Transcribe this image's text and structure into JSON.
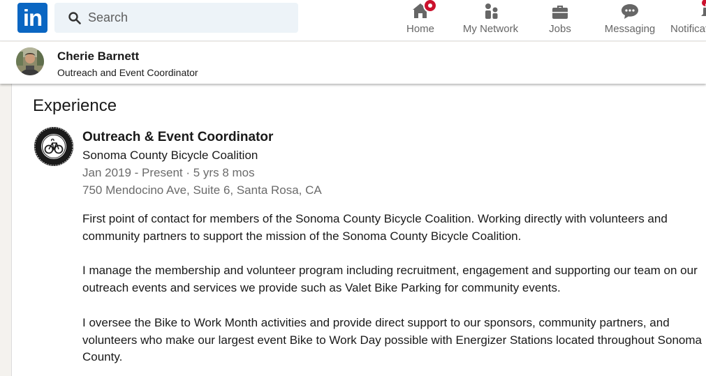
{
  "nav": {
    "logo_text": "in",
    "search_placeholder": "Search",
    "items": [
      {
        "label": "Home",
        "icon": "home-icon",
        "badge": true
      },
      {
        "label": "My Network",
        "icon": "network-icon"
      },
      {
        "label": "Jobs",
        "icon": "briefcase-icon"
      },
      {
        "label": "Messaging",
        "icon": "messaging-icon"
      },
      {
        "label": "Notifications",
        "icon": "bell-icon",
        "badge": true
      }
    ]
  },
  "profile": {
    "name": "Cherie Barnett",
    "headline": "Outreach and Event Coordinator"
  },
  "experience": {
    "section_title": "Experience",
    "title": "Outreach & Event Coordinator",
    "company": "Sonoma County Bicycle Coalition",
    "dates": "Jan 2019 - Present · 5 yrs 8 mos",
    "location": "750 Mendocino Ave, Suite 6, Santa Rosa, CA",
    "logo_text": "SONOMA COUNTY BICYCLE COALITION",
    "description": [
      "First point of contact for members of the Sonoma County Bicycle Coalition. Working directly with volunteers and community partners to support the mission of the Sonoma County Bicycle Coalition.",
      "I manage the membership and volunteer program including recruitment, engagement and supporting our team on our outreach events and services we provide such as Valet Bike Parking for community events.",
      "I oversee the Bike to Work Month activities and provide direct support to our sponsors, community partners, and volunteers who make our largest event Bike to Work Day possible with Energizer Stations located throughout Sonoma County."
    ]
  },
  "colors": {
    "brand": "#0a66c2",
    "badge": "#cb112d",
    "muted_text": "#6b6b6b",
    "page_bg": "#f4f2ee"
  }
}
